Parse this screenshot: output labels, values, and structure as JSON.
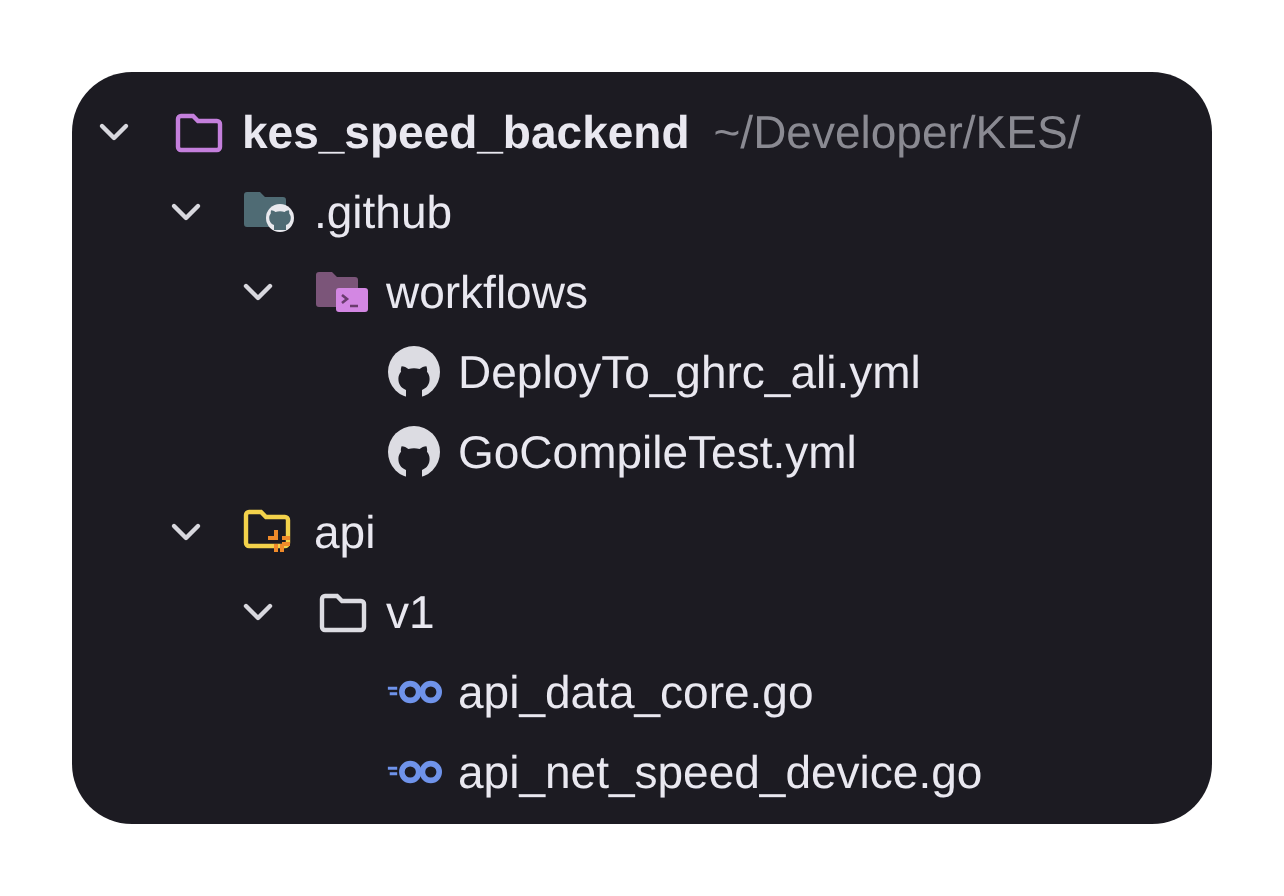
{
  "tree": [
    {
      "name": "kes_speed_backend",
      "hint": "~/Developer/KES/",
      "kind": "project-folder",
      "expanded": true,
      "children": [
        {
          "name": ".github",
          "kind": "github-folder",
          "expanded": true,
          "children": [
            {
              "name": "workflows",
              "kind": "workflow-folder",
              "expanded": true,
              "children": [
                {
                  "name": "DeployTo_ghrc_ali.yml",
                  "kind": "github-file"
                },
                {
                  "name": "GoCompileTest.yml",
                  "kind": "github-file"
                }
              ]
            }
          ]
        },
        {
          "name": "api",
          "kind": "api-folder",
          "expanded": true,
          "children": [
            {
              "name": "v1",
              "kind": "folder",
              "expanded": true,
              "children": [
                {
                  "name": "api_data_core.go",
                  "kind": "go-file"
                },
                {
                  "name": "api_net_speed_device.go",
                  "kind": "go-file"
                }
              ]
            }
          ]
        }
      ]
    }
  ]
}
